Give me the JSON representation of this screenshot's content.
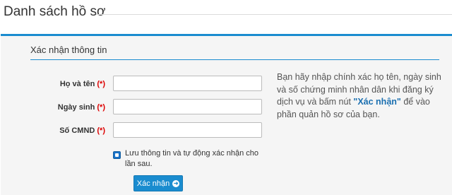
{
  "header": {
    "title": "Danh sách hồ sơ"
  },
  "panel": {
    "heading": "Xác nhận thông tin"
  },
  "form": {
    "fullname_label": "Họ và tên",
    "dob_label": "Ngày sinh",
    "id_label": "Số CMND",
    "required_mark": "(*)",
    "remember_label": "Lưu thông tin và tự động xác nhận cho lần sau.",
    "submit_label": "Xác nhận",
    "remember_checked": true
  },
  "help": {
    "text_before": "Bạn hãy nhập chính xác họ tên, ngày sinh và số chứng minh nhân dân khi đăng ký dịch vụ và bấm nút ",
    "highlight": "\"Xác nhận\"",
    "text_after": " để vào phần quản hồ sơ của bạn."
  },
  "colors": {
    "accent": "#1a8ccf",
    "required": "#dd0000"
  }
}
